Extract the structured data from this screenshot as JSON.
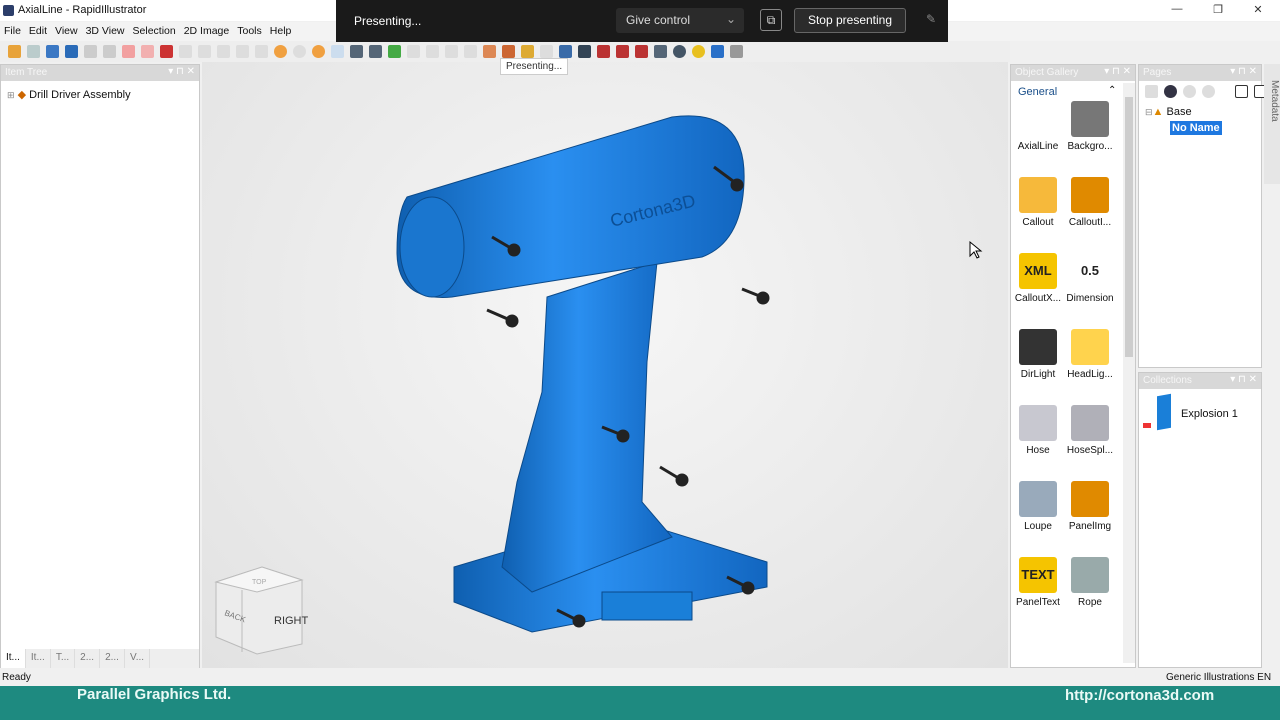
{
  "window": {
    "title": "AxialLine - RapidIllustrator",
    "minimize": "—",
    "restore": "❐",
    "close": "✕"
  },
  "menu": [
    "File",
    "Edit",
    "View",
    "3D View",
    "Selection",
    "2D Image",
    "Tools",
    "Help"
  ],
  "presenting": {
    "status": "Presenting...",
    "give_control": "Give control",
    "stop": "Stop presenting",
    "tooltip": "Presenting..."
  },
  "item_tree": {
    "title": "Item Tree",
    "root": "Drill Driver Assembly",
    "tabs": [
      "It...",
      "It...",
      "T...",
      "2...",
      "2...",
      "V..."
    ]
  },
  "viewport": {
    "logo": "Cortona3D",
    "cube": {
      "front": "RIGHT",
      "side": "BACK",
      "top": "TOP"
    }
  },
  "gallery": {
    "title": "Object Gallery",
    "section": "General",
    "items": [
      {
        "label": "AxialLine",
        "color": "#ffffff"
      },
      {
        "label": "Backgro...",
        "color": "#777777"
      },
      {
        "label": "Callout",
        "color": "#f6b93b"
      },
      {
        "label": "CalloutI...",
        "color": "#e08a00"
      },
      {
        "label": "CalloutX...",
        "color": "#f5c400",
        "glyph": "XML"
      },
      {
        "label": "Dimension",
        "color": "#ffffff",
        "glyph": "0.5"
      },
      {
        "label": "DirLight",
        "color": "#333333"
      },
      {
        "label": "HeadLig...",
        "color": "#ffd34d"
      },
      {
        "label": "Hose",
        "color": "#c8c8d0"
      },
      {
        "label": "HoseSpl...",
        "color": "#b0b0b8"
      },
      {
        "label": "Loupe",
        "color": "#9ab"
      },
      {
        "label": "PanelImg",
        "color": "#e08a00"
      },
      {
        "label": "PanelText",
        "color": "#f5c400",
        "glyph": "TEXT"
      },
      {
        "label": "Rope",
        "color": "#9aa"
      }
    ]
  },
  "pages": {
    "title": "Pages",
    "root": "Base",
    "selected": "No Name"
  },
  "collections": {
    "title": "Collections",
    "items": [
      "Explosion 1"
    ]
  },
  "metadata": "Metadata",
  "status": {
    "left": "Ready",
    "right": "Generic Illustrations EN"
  },
  "footer": {
    "left": "Parallel Graphics Ltd.",
    "right": "http://cortona3d.com"
  },
  "colors": {
    "model": "#1a7fd8",
    "footer": "#1e8a80",
    "selection": "#1e78e0"
  }
}
